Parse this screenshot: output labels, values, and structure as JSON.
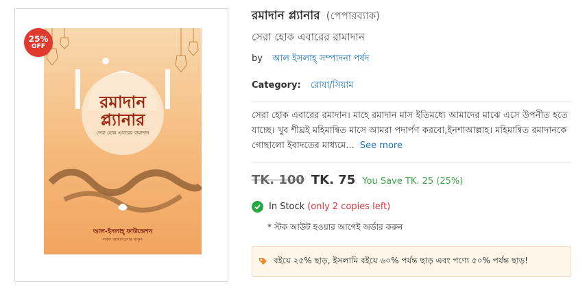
{
  "product": {
    "title": "রমাদান প্ল্যানার",
    "format": "(পেপারব্যাক)",
    "subtitle": "সেরা হোক এবারের রামাদান",
    "by_label": "by",
    "author": "আল ইসলাহ্ সম্পাদনা পর্ষদ",
    "category_label": "Category:",
    "category": "রোযা/সিয়াম",
    "description": "সেরা হোক এবারের রমাদান। মাহে রমাদান মাস ইতিমধ্যে আমাদের মাঝে এসে উপনীত হতে যাচ্ছে। খুব শীঘ্রই মহিমান্বিত মাসে আমরা পদার্পণ করবো,ইনশাআল্লাহ। মহিমান্বিত রমাদানকে গোছালো ইবাদতের মাধ্যমে...",
    "see_more": "See more"
  },
  "badge": {
    "percent": "25%",
    "off": "OFF"
  },
  "cover": {
    "title_line1": "রমাদান",
    "title_line2": "প্ল্যানার",
    "tagline": "সেরা হোক এবারের রামাদান",
    "publisher": "আল-ইসলাহ্ ফাউন্ডেশন",
    "publisher_sub": "সর্বদা আমানতদার থাকুন"
  },
  "pricing": {
    "old_price": "TK. 100",
    "new_price": "TK. 75",
    "you_save": "You Save TK. 25 (25%)"
  },
  "stock": {
    "status": "In Stock",
    "copies_left": "(only 2 copies left)",
    "note": "* স্টক আউট হওয়ার আগেই অর্ডার করুন"
  },
  "offer": {
    "text": "বইয়ে ২৫% ছাড়, ইসলামি বইয়ে ৬০% পর্যন্ত ছাড় এবং পণ্যে ৫০% পর্যন্ত ছাড়!"
  },
  "colors": {
    "badge": "#e03a2f",
    "link": "#1a73b8",
    "save_green": "#3aa649",
    "stock_green": "#28a745",
    "copies_red": "#d9363e",
    "offer_bg": "#fdf6e9",
    "tag_orange": "#f28b30",
    "cover_orange": "#f2a45f"
  }
}
